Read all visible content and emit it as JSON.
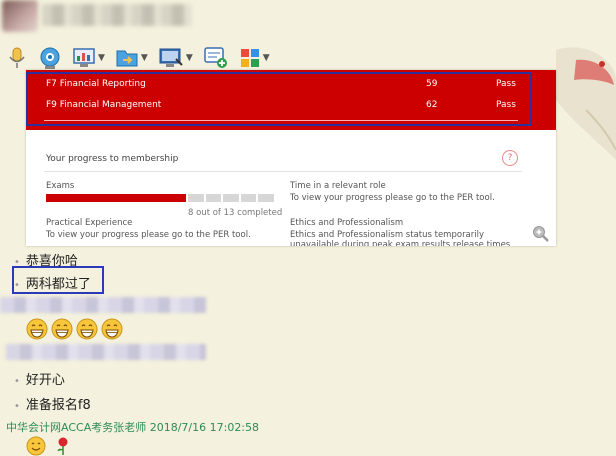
{
  "card": {
    "results": [
      {
        "subject": "F7 Financial Reporting",
        "score": "59",
        "result": "Pass"
      },
      {
        "subject": "F9 Financial Management",
        "score": "62",
        "result": "Pass"
      }
    ],
    "progress_title": "Your progress to membership",
    "help_glyph": "?",
    "exams_label": "Exams",
    "exams_completed": 8,
    "exams_total": 13,
    "exams_status": "8 out of 13 completed",
    "practical_label": "Practical Experience",
    "practical_text": "To view your progress please go to the PER tool.",
    "time_label": "Time in a relevant role",
    "time_text": "To view your progress please go to the PER tool.",
    "ethics_label": "Ethics and Professionalism",
    "ethics_text1": "Ethics and Professionalism status temporarily",
    "ethics_text2": "unavailable during peak exam results release times"
  },
  "chat": {
    "messages": [
      "恭喜你哈",
      "两科都过了",
      "好开心",
      "准备报名f8"
    ],
    "sender": "中华会计网ACCA考务张老师 2018/7/16 17:02:58"
  },
  "toolbar": {
    "icons": [
      "microphone-icon",
      "webcam-icon",
      "screen-share-icon",
      "send-file-icon",
      "remote-desktop-icon",
      "message-add-icon",
      "apps-icon"
    ]
  },
  "colors": {
    "accent_red": "#cc0000",
    "highlight_blue": "#2a3ab8",
    "sender_green": "#2e8b57"
  }
}
